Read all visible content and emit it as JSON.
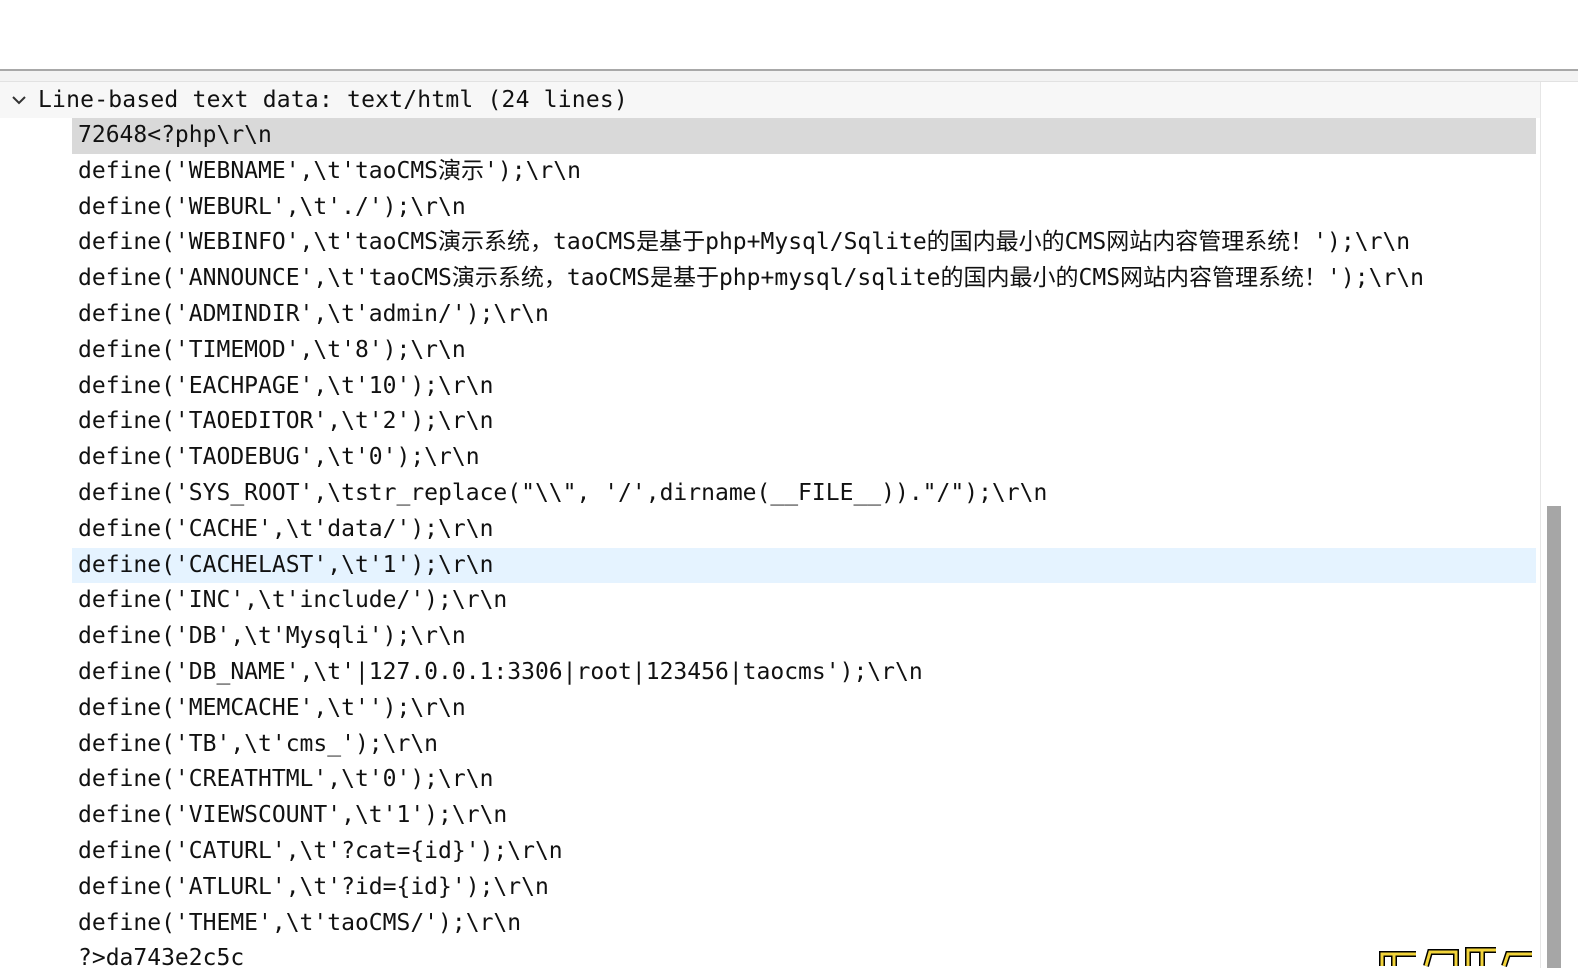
{
  "packet_detail": {
    "header_label": "Line-based text data: text/html (24 lines)",
    "lines": [
      "72648<?php\\r\\n",
      "define('WEBNAME',\\t'taoCMS演示');\\r\\n",
      "define('WEBURL',\\t'./');\\r\\n",
      "define('WEBINFO',\\t'taoCMS演示系统，taoCMS是基于php+Mysql/Sqlite的国内最小的CMS网站内容管理系统！');\\r\\n",
      "define('ANNOUNCE',\\t'taoCMS演示系统，taoCMS是基于php+mysql/sqlite的国内最小的CMS网站内容管理系统！');\\r\\n",
      "define('ADMINDIR',\\t'admin/');\\r\\n",
      "define('TIMEMOD',\\t'8');\\r\\n",
      "define('EACHPAGE',\\t'10');\\r\\n",
      "define('TAOEDITOR',\\t'2');\\r\\n",
      "define('TAODEBUG',\\t'0');\\r\\n",
      "define('SYS_ROOT',\\tstr_replace(\"\\\\\", '/',dirname(__FILE__)).\"/\");\\r\\n",
      "define('CACHE',\\t'data/');\\r\\n",
      "define('CACHELAST',\\t'1');\\r\\n",
      "define('INC',\\t'include/');\\r\\n",
      "define('DB',\\t'Mysqli');\\r\\n",
      "define('DB_NAME',\\t'|127.0.0.1:3306|root|123456|taocms');\\r\\n",
      "define('MEMCACHE',\\t'');\\r\\n",
      "define('TB',\\t'cms_');\\r\\n",
      "define('CREATHTML',\\t'0');\\r\\n",
      "define('VIEWSCOUNT',\\t'1');\\r\\n",
      "define('CATURL',\\t'?cat={id}');\\r\\n",
      "define('ATLURL',\\t'?id={id}');\\r\\n",
      "define('THEME',\\t'taoCMS/');\\r\\n",
      "?>da743e2c5c"
    ]
  },
  "icons": {
    "expand": "chevron-down-icon"
  },
  "colors": {
    "selected_row": "#d9d9d9",
    "hover_row": "#e5f3ff",
    "scroll_thumb": "#a6a6a6"
  }
}
